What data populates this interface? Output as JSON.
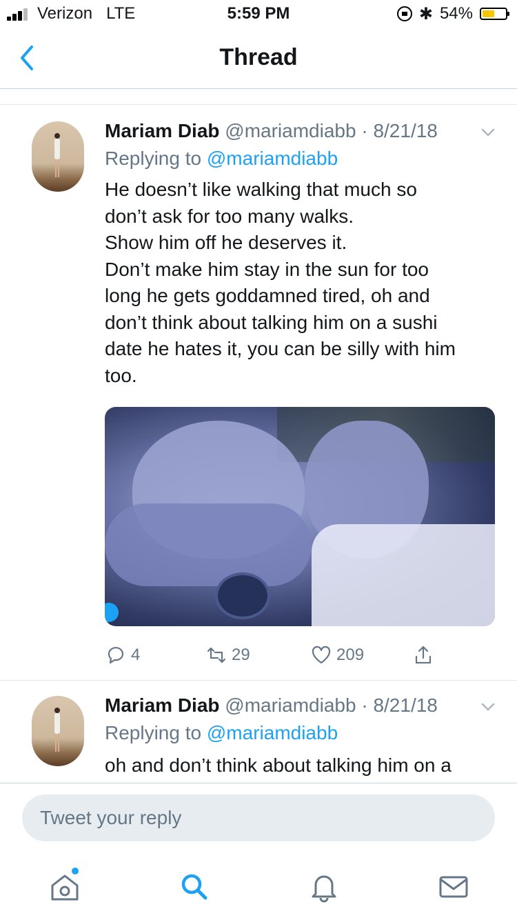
{
  "status_bar": {
    "carrier": "Verizon",
    "network": "LTE",
    "time": "5:59 PM",
    "battery": "54%",
    "battery_level": 0.54
  },
  "nav": {
    "title": "Thread"
  },
  "tweets": [
    {
      "name": "Mariam Diab",
      "handle": "@mariamdiabb",
      "date": "8/21/18",
      "replying_label": "Replying to",
      "replying_handle": "@mariamdiabb",
      "text": "He doesn’t like walking that much so\ndon’t ask for too many walks.\nShow him off he deserves it.\nDon’t make him stay in the sun for too\nlong he gets goddamned tired, oh and\ndon’t think about talking him on a sushi\ndate he hates it, you can be silly with him\ntoo.",
      "replies": "4",
      "retweets": "29",
      "likes": "209"
    },
    {
      "name": "Mariam Diab",
      "handle": "@mariamdiabb",
      "date": "8/21/18",
      "replying_label": "Replying to",
      "replying_handle": "@mariamdiabb",
      "text": "oh and don’t think about talking him on a"
    }
  ],
  "reply": {
    "placeholder": "Tweet your reply"
  },
  "tabs": [
    "home-icon",
    "search-icon",
    "notifications-icon",
    "messages-icon"
  ],
  "colors": {
    "accent": "#1da1f2",
    "text": "#14171a",
    "muted": "#657786",
    "battery": "#f5c800"
  }
}
